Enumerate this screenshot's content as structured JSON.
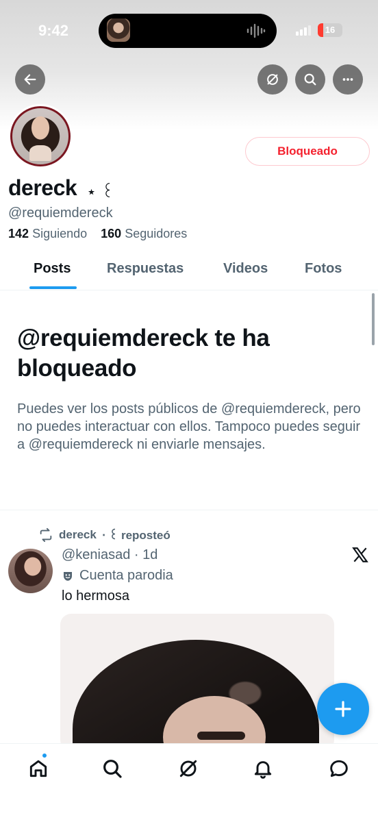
{
  "status_bar": {
    "time": "9:42",
    "battery": "16"
  },
  "top_nav": {
    "back_icon": "arrow-left-icon",
    "grok_icon": "grok-icon",
    "search_icon": "search-icon",
    "more_icon": "more-horizontal-icon"
  },
  "profile": {
    "display_name": "dereck",
    "name_decoration": "⋆ ꒰",
    "handle": "@requiemdereck",
    "following_count": "142",
    "following_label": "Siguiendo",
    "followers_count": "160",
    "followers_label": "Seguidores",
    "blocked_button": "Bloqueado"
  },
  "tabs": [
    {
      "label": "Posts",
      "active": true
    },
    {
      "label": "Respuestas",
      "active": false
    },
    {
      "label": "Videos",
      "active": false
    },
    {
      "label": "Fotos",
      "active": false
    }
  ],
  "blocked_notice": {
    "title": "@requiemdereck te ha bloqueado",
    "description": "Puedes ver los posts públicos de @requiemdereck, pero no puedes interactuar con ellos. Tampoco puedes seguir a @requiemdereck ni enviarle mensajes."
  },
  "post": {
    "repost_name": "dereck",
    "repost_suffix": "⋅ ꒰ reposteó",
    "author_handle": "@keniasad",
    "time": "1d",
    "parody_label": "Cuenta parodia",
    "text": "lo hermosa"
  },
  "bottom_nav": [
    "home-icon",
    "search-icon",
    "grok-icon",
    "notifications-icon",
    "messages-icon"
  ],
  "colors": {
    "accent": "#1d9bf0",
    "blocked_red": "#f4212e",
    "secondary_text": "#536471"
  }
}
